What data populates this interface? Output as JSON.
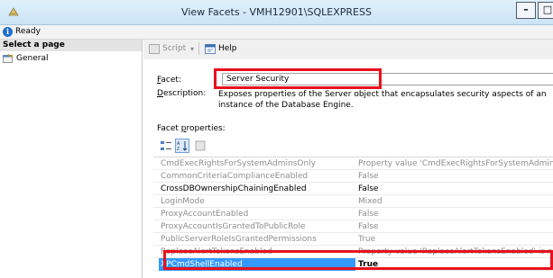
{
  "window": {
    "title": "View Facets - VMH12901\\SQLEXPRESS",
    "min_label": "–",
    "max_label": "□"
  },
  "status": {
    "text": "Ready"
  },
  "left_panel": {
    "header": "Select a page",
    "pages": [
      {
        "label": "General"
      }
    ]
  },
  "toolbar": {
    "script_label": "Script",
    "script_dropdown": "▾",
    "help_label": "Help"
  },
  "facet": {
    "label_prefix": "",
    "label_accel": "F",
    "label_rest": "acet:",
    "value": "Server Security"
  },
  "description": {
    "label_accel": "D",
    "label_rest": "escription:",
    "text": "Exposes properties of the Server object that encapsulates security aspects of an instance of the Database Engine."
  },
  "facet_properties": {
    "label_prefix": "Facet ",
    "label_accel": "p",
    "label_rest": "roperties:"
  },
  "properties": [
    {
      "name": "CmdExecRightsForSystemAdminsOnly",
      "value": "Property value 'CmdExecRightsForSystemAdminsOnly' i",
      "enabled": false
    },
    {
      "name": "CommonCriteriaComplianceEnabled",
      "value": "False",
      "enabled": false
    },
    {
      "name": "CrossDBOwnershipChainingEnabled",
      "value": "False",
      "enabled": true
    },
    {
      "name": "LoginMode",
      "value": "Mixed",
      "enabled": false
    },
    {
      "name": "ProxyAccountEnabled",
      "value": "False",
      "enabled": false
    },
    {
      "name": "ProxyAccountIsGrantedToPublicRole",
      "value": "False",
      "enabled": false
    },
    {
      "name": "PublicServerRoleIsGrantedPermissions",
      "value": "True",
      "enabled": false
    },
    {
      "name": "ReplaceAlertTokensEnabled",
      "value": "Property value 'ReplaceAlertTokensEnabled' is not availa",
      "enabled": false
    },
    {
      "name": "XPCmdShellEnabled",
      "value": "True",
      "enabled": true,
      "selected": true
    }
  ],
  "colors": {
    "highlight": "#e8101c",
    "selection": "#3399ff"
  }
}
